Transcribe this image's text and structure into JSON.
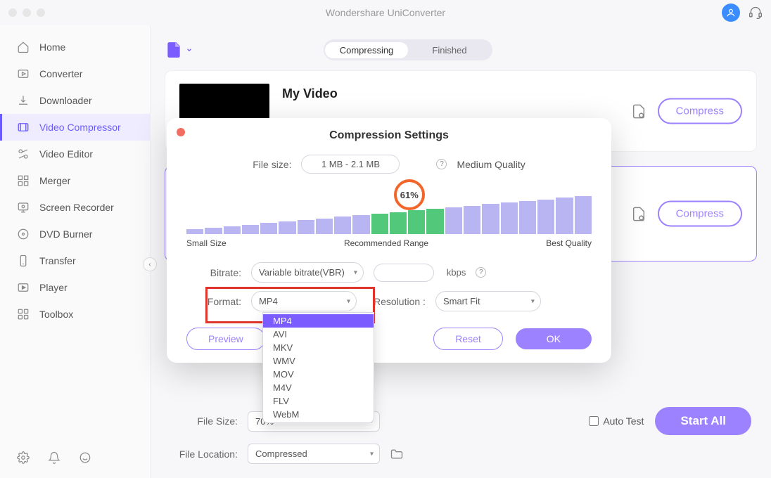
{
  "titlebar": {
    "app_title": "Wondershare UniConverter"
  },
  "sidebar": {
    "items": [
      {
        "label": "Home"
      },
      {
        "label": "Converter"
      },
      {
        "label": "Downloader"
      },
      {
        "label": "Video Compressor"
      },
      {
        "label": "Video Editor"
      },
      {
        "label": "Merger"
      },
      {
        "label": "Screen Recorder"
      },
      {
        "label": "DVD Burner"
      },
      {
        "label": "Transfer"
      },
      {
        "label": "Player"
      },
      {
        "label": "Toolbox"
      }
    ]
  },
  "segmented": {
    "compressing": "Compressing",
    "finished": "Finished"
  },
  "video": {
    "title": "My Video",
    "compress_label": "Compress"
  },
  "modal": {
    "title": "Compression Settings",
    "file_size_label": "File size:",
    "file_size_value": "1 MB - 2.1 MB",
    "quality_text": "Medium Quality",
    "percent": "61%",
    "small_size": "Small Size",
    "recommended": "Recommended Range",
    "best_quality": "Best Quality",
    "bitrate_label": "Bitrate:",
    "bitrate_value": "Variable bitrate(VBR)",
    "kbps": "kbps",
    "format_label": "Format:",
    "format_value": "MP4",
    "resolution_label": "Resolution :",
    "resolution_value": "Smart Fit",
    "preview": "Preview",
    "reset": "Reset",
    "ok": "OK",
    "options": [
      "MP4",
      "AVI",
      "MKV",
      "WMV",
      "MOV",
      "M4V",
      "FLV",
      "WebM"
    ]
  },
  "bottom": {
    "file_size_label": "File Size:",
    "file_size_value": "70%",
    "file_location_label": "File Location:",
    "file_location_value": "Compressed",
    "auto_test": "Auto Test",
    "start_all": "Start  All"
  }
}
